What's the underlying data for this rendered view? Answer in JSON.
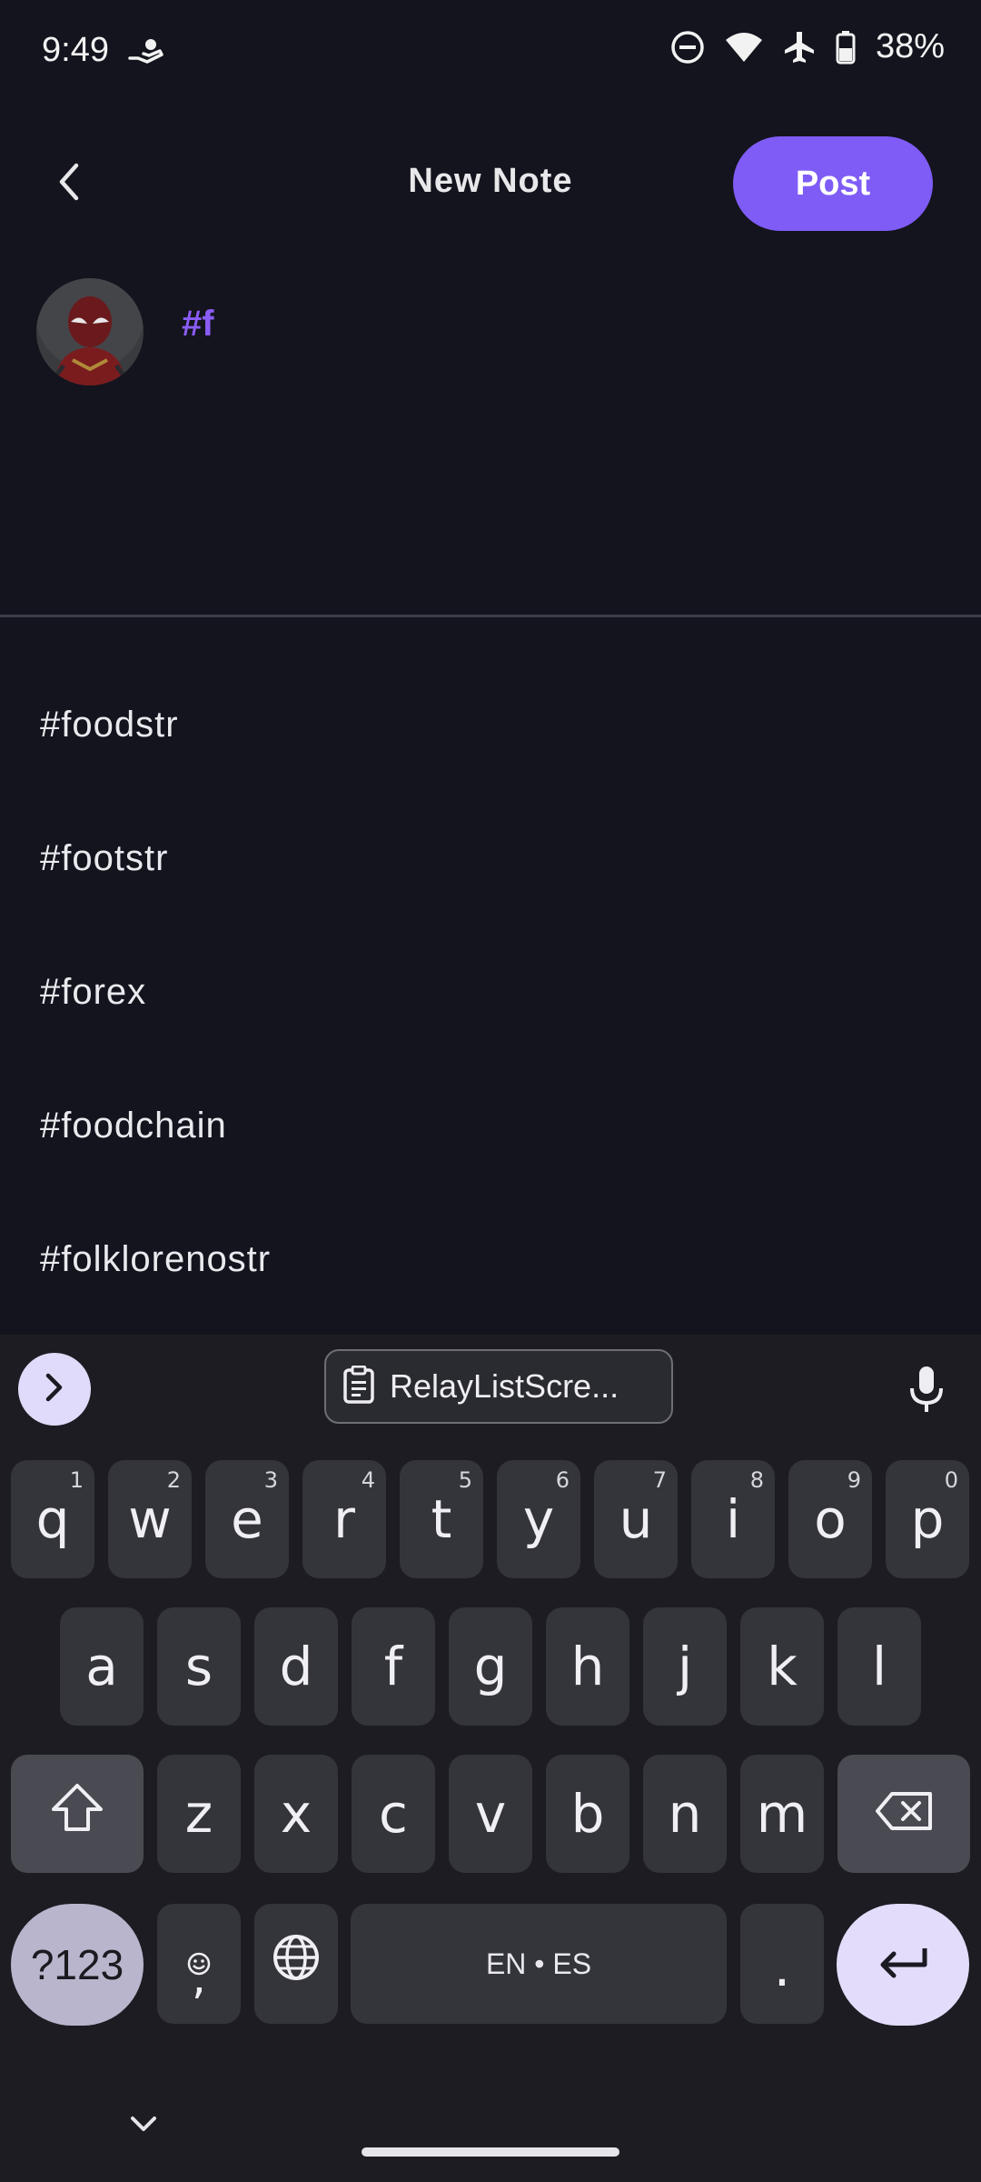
{
  "status_bar": {
    "time": "9:49",
    "battery": "38%",
    "icons": [
      "hand-hold-icon",
      "do-not-disturb-icon",
      "wifi-icon",
      "airplane-icon",
      "battery-icon"
    ]
  },
  "app_bar": {
    "title": "New Note",
    "post_label": "Post",
    "back_icon": "chevron-left-icon"
  },
  "composer": {
    "text": "#f"
  },
  "suggestions": [
    "#foodstr",
    "#footstr",
    "#forex",
    "#foodchain",
    "#folklorenostr"
  ],
  "keyboard": {
    "clipboard_text": "RelayListScre...",
    "row1": [
      {
        "k": "q",
        "n": "1"
      },
      {
        "k": "w",
        "n": "2"
      },
      {
        "k": "e",
        "n": "3"
      },
      {
        "k": "r",
        "n": "4"
      },
      {
        "k": "t",
        "n": "5"
      },
      {
        "k": "y",
        "n": "6"
      },
      {
        "k": "u",
        "n": "7"
      },
      {
        "k": "i",
        "n": "8"
      },
      {
        "k": "o",
        "n": "9"
      },
      {
        "k": "p",
        "n": "0"
      }
    ],
    "row2": [
      "a",
      "s",
      "d",
      "f",
      "g",
      "h",
      "j",
      "k",
      "l"
    ],
    "row3": [
      "z",
      "x",
      "c",
      "v",
      "b",
      "n",
      "m"
    ],
    "symbols_label": "?123",
    "comma_label": ",",
    "space_label": "EN • ES",
    "period_label": "."
  },
  "colors": {
    "background": "#13141d",
    "accent": "#7f5cf6",
    "hashtag": "#8a5cf6",
    "key": "#34343b"
  }
}
